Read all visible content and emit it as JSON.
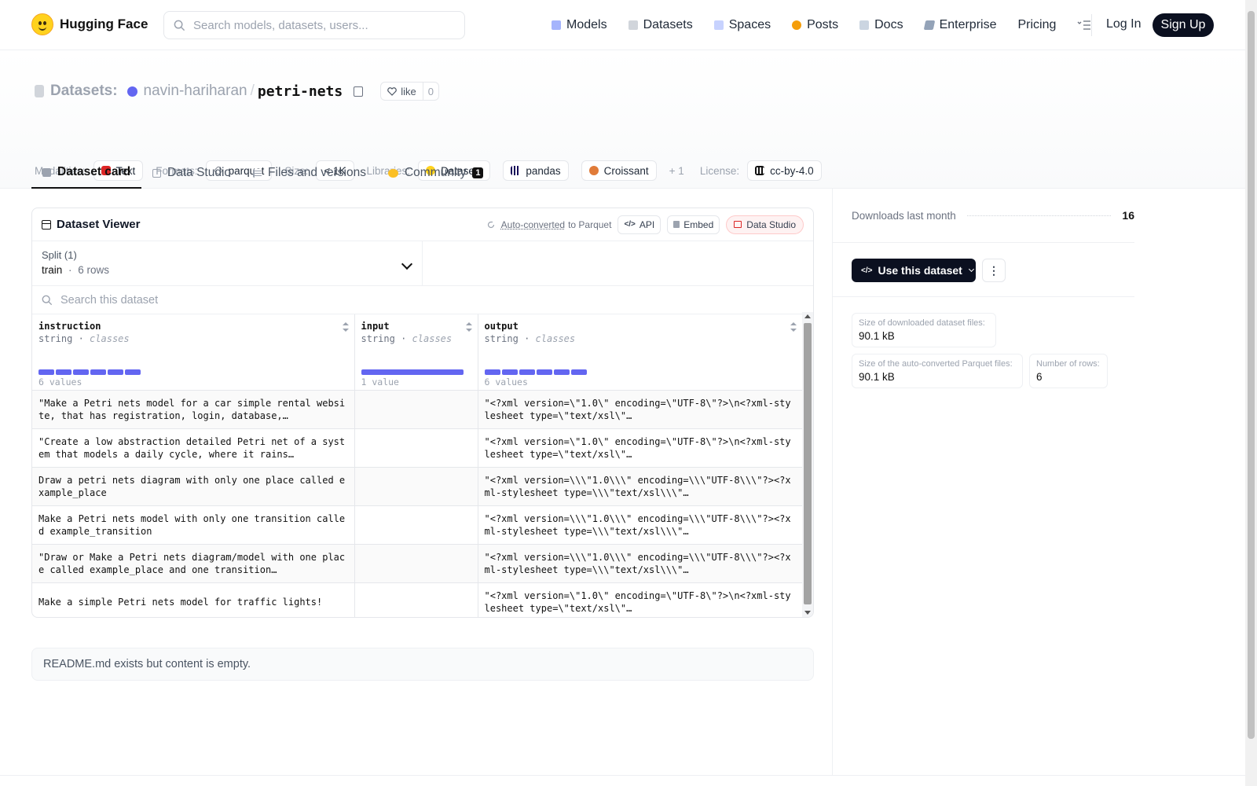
{
  "nav": {
    "brand": "Hugging Face",
    "search_placeholder": "Search models, datasets, users...",
    "links": [
      "Models",
      "Datasets",
      "Spaces",
      "Posts",
      "Docs",
      "Enterprise",
      "Pricing"
    ],
    "login": "Log In",
    "signup": "Sign Up"
  },
  "repo": {
    "section": "Datasets:",
    "owner": "navin-hariharan",
    "separator": "/",
    "name": "petri-nets",
    "like_label": "like",
    "like_count": "0"
  },
  "meta": {
    "modalities_label": "Modalities:",
    "modality": "Text",
    "formats_label": "Formats:",
    "format": "parquet",
    "size_label": "Size:",
    "size": "< 1K",
    "libraries_label": "Libraries:",
    "libraries": [
      "Datasets",
      "pandas",
      "Croissant"
    ],
    "libraries_more": "+ 1",
    "license_label": "License:",
    "license": "cc-by-4.0"
  },
  "tabs": [
    {
      "label": "Dataset card",
      "active": true
    },
    {
      "label": "Data Studio"
    },
    {
      "label": "Files and versions"
    },
    {
      "label": "Community",
      "badge": "1"
    }
  ],
  "viewer": {
    "title": "Dataset Viewer",
    "auto_converted": "Auto-converted",
    "to_parquet": "to Parquet",
    "api": "API",
    "embed": "Embed",
    "data_studio": "Data Studio",
    "split_label": "Split (1)",
    "split_name": "train",
    "split_dot": "·",
    "split_rows": "6 rows",
    "search_placeholder": "Search this dataset",
    "columns": [
      {
        "name": "instruction",
        "type": "string",
        "kind": "classes",
        "values": "6 values",
        "bars": 6
      },
      {
        "name": "input",
        "type": "string",
        "kind": "classes",
        "values": "1 value",
        "bars": 1
      },
      {
        "name": "output",
        "type": "string",
        "kind": "classes",
        "values": "6 values",
        "bars": 6
      }
    ],
    "rows": [
      [
        "\"Make a Petri nets model for a car simple rental website, that has registration, login, database,…",
        "",
        "\"<?xml version=\\\"1.0\\\" encoding=\\\"UTF-8\\\"?>\\n<?xml-stylesheet type=\\\"text/xsl\\\"…"
      ],
      [
        "\"Create a low abstraction detailed Petri net of a system that models a daily cycle, where it rains…",
        "",
        "\"<?xml version=\\\"1.0\\\" encoding=\\\"UTF-8\\\"?>\\n<?xml-stylesheet type=\\\"text/xsl\\\"…"
      ],
      [
        "Draw a petri nets diagram with only one place called example_place",
        "",
        "\"<?xml version=\\\\\\\"1.0\\\\\\\" encoding=\\\\\\\"UTF-8\\\\\\\"?><?xml-stylesheet type=\\\\\\\"text/xsl\\\\\\\"…"
      ],
      [
        "Make a Petri nets model with only one transition called example_transition",
        "",
        "\"<?xml version=\\\\\\\"1.0\\\\\\\" encoding=\\\\\\\"UTF-8\\\\\\\"?><?xml-stylesheet type=\\\\\\\"text/xsl\\\\\\\"…"
      ],
      [
        "\"Draw or Make a Petri nets diagram/model with one place called example_place and one transition…",
        "",
        "\"<?xml version=\\\\\\\"1.0\\\\\\\" encoding=\\\\\\\"UTF-8\\\\\\\"?><?xml-stylesheet type=\\\\\\\"text/xsl\\\\\\\"…"
      ],
      [
        "Make a simple Petri nets model for traffic lights!",
        "",
        "\"<?xml version=\\\"1.0\\\" encoding=\\\"UTF-8\\\"?>\\n<?xml-stylesheet type=\\\"text/xsl\\\"…"
      ]
    ]
  },
  "readme": "README.md exists but content is empty.",
  "sidebar": {
    "downloads_label": "Downloads last month",
    "downloads_value": "16",
    "use_button": "Use this dataset",
    "stats": [
      {
        "label": "Size of downloaded dataset files:",
        "value": "90.1 kB"
      },
      {
        "label": "Size of the auto-converted Parquet files:",
        "value": "90.1 kB"
      },
      {
        "label": "Number of rows:",
        "value": "6"
      }
    ]
  },
  "colors": {
    "accent": "#6366f1",
    "dark": "#0b1020"
  }
}
